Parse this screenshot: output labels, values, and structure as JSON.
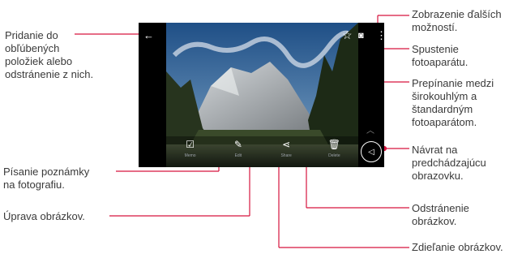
{
  "colors": {
    "accent": "#d6153e",
    "text": "#3a3a3a"
  },
  "labels": {
    "favorites": "Pridanie do\nobľúbených\npoložiek alebo\nodstránenie z nich.",
    "more_options": "Zobrazenie ďalších\nmožností.",
    "camera": "Spustenie\nfotoaparátu.",
    "switch_camera": "Prepínanie medzi\nširokouhlým a\nštandardným\nfotoaparátom.",
    "back": "Návrat na\npredchádzajúcu\nobrazovku.",
    "memo": "Písanie poznámky\nna fotografiu.",
    "edit": "Úprava obrázkov.",
    "delete": "Odstránenie\nobrázkov.",
    "share": "Zdieľanie obrázkov."
  },
  "phone": {
    "top_icons": {
      "back": "arrow-back-icon",
      "favorite": "star-icon",
      "camera": "camera-icon",
      "more": "more-vertical-icon"
    },
    "edit_bar": [
      {
        "icon": "memo-icon",
        "glyph": "☑",
        "caption": "Memo"
      },
      {
        "icon": "pencil-icon",
        "glyph": "✎",
        "caption": "Edit"
      },
      {
        "icon": "share-icon",
        "glyph": "⋖",
        "caption": "Share"
      },
      {
        "icon": "trash-icon",
        "glyph": "🗑",
        "caption": "Delete"
      }
    ]
  }
}
